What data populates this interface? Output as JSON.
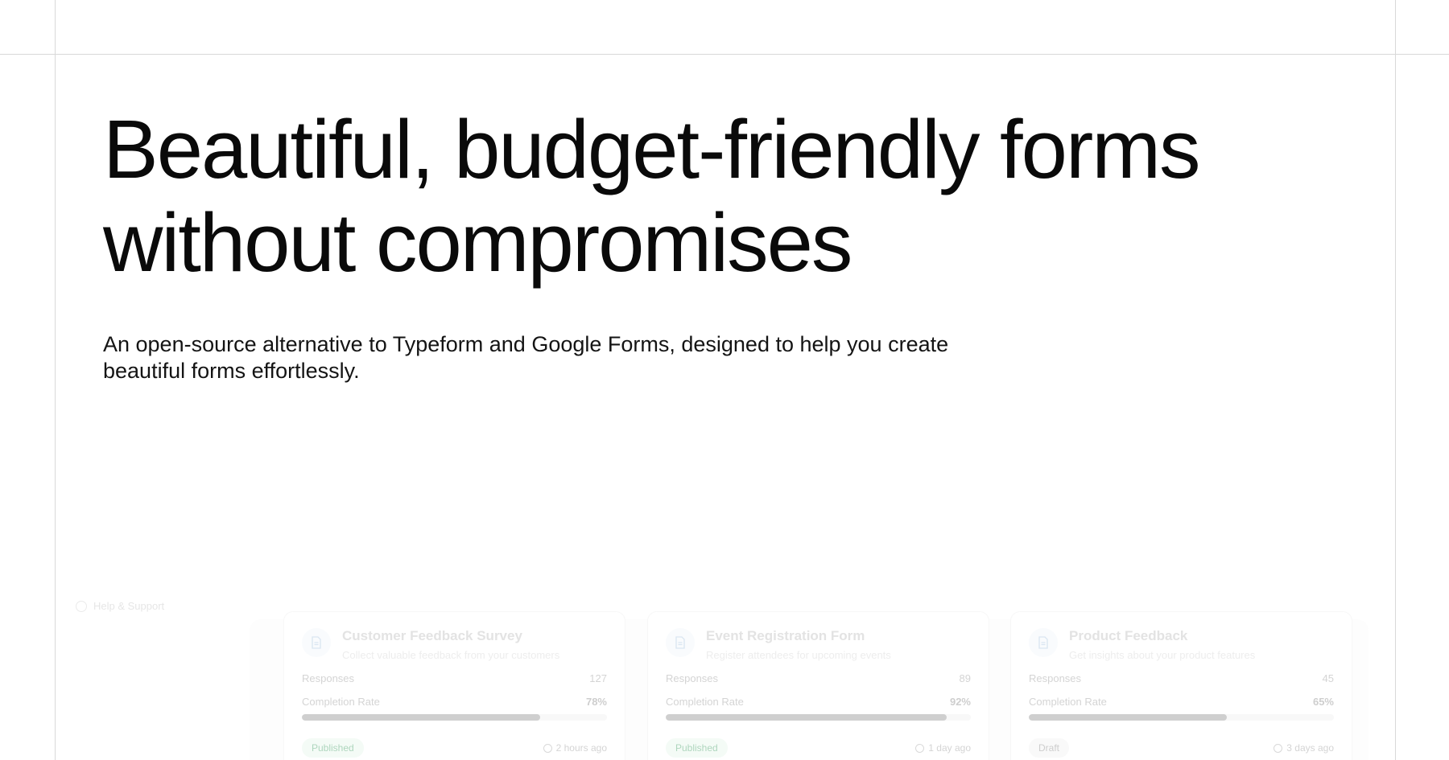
{
  "hero": {
    "title_line1": "Beautiful, budget-friendly forms",
    "title_line2": "without compromises",
    "subtitle": "An open-source alternative to Typeform and Google Forms, designed to help you create beautiful forms effortlessly."
  },
  "sidebar": {
    "help_label": "Help & Support"
  },
  "labels": {
    "responses": "Responses",
    "completion_rate": "Completion Rate"
  },
  "forms": [
    {
      "title": "Customer Feedback Survey",
      "description": "Collect valuable feedback from your customers",
      "responses": "127",
      "completion_rate": "78%",
      "completion": 0.78,
      "status": "Published",
      "updated": "2 hours ago"
    },
    {
      "title": "Event Registration Form",
      "description": "Register attendees for upcoming events",
      "responses": "89",
      "completion_rate": "92%",
      "completion": 0.92,
      "status": "Published",
      "updated": "1 day ago"
    },
    {
      "title": "Product Feedback",
      "description": "Get insights about your product features",
      "responses": "45",
      "completion_rate": "65%",
      "completion": 0.65,
      "status": "Draft",
      "updated": "3 days ago"
    }
  ],
  "colors": {
    "published_badge": "#e6f6ec",
    "published_text": "#3f9e63",
    "draft_badge": "#f1f1f1",
    "progress_fill": "#8f8f8f"
  }
}
